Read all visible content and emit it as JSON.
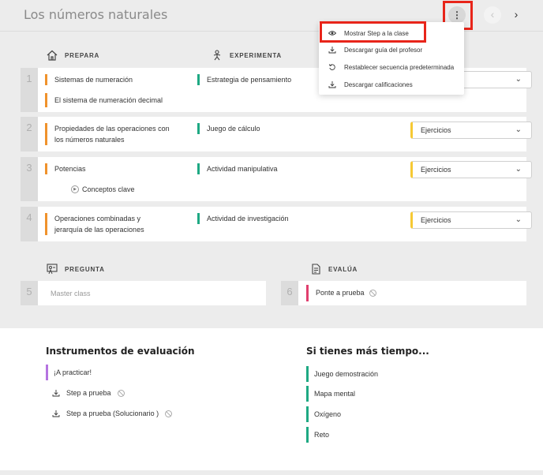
{
  "header": {
    "title": "Los números naturales",
    "kebab_glyph": "⋮",
    "prev_glyph": "‹",
    "next_glyph": "›"
  },
  "sections": {
    "prepara": "PREPARA",
    "experimenta": "EXPERIMENTA",
    "pregunta": "PREGUNTA",
    "evalua": "EVALÚA"
  },
  "rows": [
    {
      "num": "1",
      "prepara": "Sistemas de numeración",
      "prepara_extra": "El sistema de numeración decimal",
      "experimenta": "Estrategia de pensamiento",
      "select": ""
    },
    {
      "num": "2",
      "prepara": "Propiedades de las operaciones con los números naturales",
      "experimenta": "Juego de cálculo",
      "select": "Ejercicios"
    },
    {
      "num": "3",
      "prepara": "Potencias",
      "concept": "Conceptos clave",
      "experimenta": "Actividad manipulativa",
      "select": "Ejercicios"
    },
    {
      "num": "4",
      "prepara": "Operaciones combinadas y jerarquía de las operaciones",
      "experimenta": "Actividad de investigación",
      "select": "Ejercicios"
    }
  ],
  "row5": {
    "num": "5",
    "placeholder": "Master class"
  },
  "row6": {
    "num": "6",
    "label": "Ponte a prueba"
  },
  "menu": {
    "items": [
      {
        "label": "Mostrar Step a la clase",
        "icon": "eye-icon"
      },
      {
        "label": "Descargar guía del profesor",
        "icon": "download-icon"
      },
      {
        "label": "Restablecer secuencia predeterminada",
        "icon": "reset-icon"
      },
      {
        "label": "Descargar calificaciones",
        "icon": "download-icon"
      }
    ]
  },
  "instrumentos": {
    "title": "Instrumentos de evaluación",
    "practicar": "¡A practicar!",
    "step": "Step a prueba",
    "step_sol": "Step a prueba (Solucionario )"
  },
  "tiempo": {
    "title": "Si tienes más tiempo...",
    "items": [
      "Juego demostración",
      "Mapa mental",
      "Oxígeno",
      "Reto"
    ]
  },
  "colors": {
    "orange": "#f0922c",
    "green": "#1ea983",
    "pink": "#e03e6e",
    "purple": "#b573e0",
    "yellow": "#f6c934",
    "highlight": "#e8251a"
  }
}
